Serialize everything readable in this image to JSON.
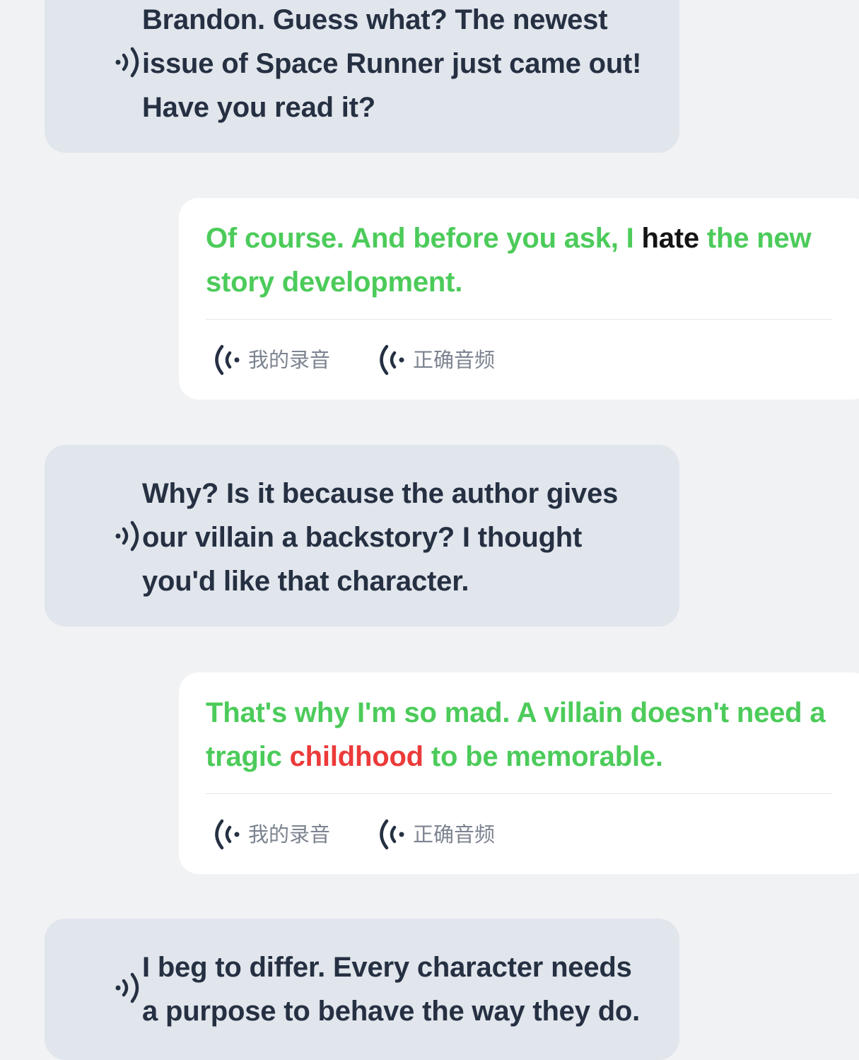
{
  "messages": [
    {
      "role": "partner",
      "lines": [
        "Brandon. Guess what? The newest",
        "issue of Space Runner just came out!",
        "Have you read it?"
      ]
    },
    {
      "role": "user",
      "segments": [
        {
          "text": "Of course. And before you ask, I ",
          "status": "good"
        },
        {
          "text": "hate",
          "status": "neutral"
        },
        {
          "text": " the new story development.",
          "status": "good"
        }
      ],
      "my_recording_label": "我的录音",
      "correct_audio_label": "正确音频"
    },
    {
      "role": "partner",
      "lines": [
        "Why? Is it because the author gives",
        "our villain a backstory? I thought",
        "you'd like that character."
      ]
    },
    {
      "role": "user",
      "segments": [
        {
          "text": "That's why I'm so mad. A villain doesn't need a tragic ",
          "status": "good"
        },
        {
          "text": "childhood",
          "status": "bad"
        },
        {
          "text": " to be memorable.",
          "status": "good"
        }
      ],
      "my_recording_label": "我的录音",
      "correct_audio_label": "正确音频"
    },
    {
      "role": "partner",
      "lines": [
        "I beg to differ. Every character needs",
        "a purpose to behave the way they do."
      ]
    }
  ],
  "colors": {
    "good": "#4ccb5a",
    "neutral": "#141414",
    "bad": "#ec3a3a",
    "partner_bubble": "#e1e5ec",
    "user_bubble": "#ffffff",
    "background": "#f1f2f4"
  },
  "icons": {
    "partner_play": "speaker-icon",
    "recording_play": "audio-wave-icon"
  }
}
